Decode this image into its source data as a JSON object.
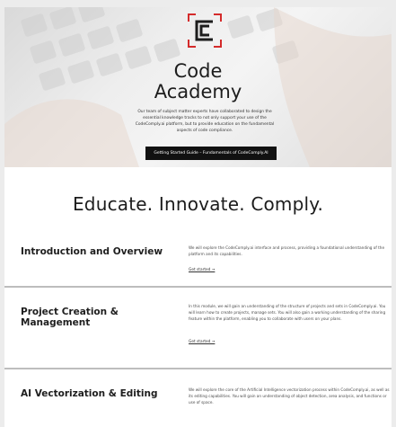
{
  "hero": {
    "title_line1": "Code",
    "title_line2": "Academy",
    "description": "Our team of subject matter experts have collaborated to design the essential knowledge tracks to not only support your use of the CodeComply.ai platform, but to provide education on the fundamental aspects of code compliance.",
    "button_label": "Getting Started Guide – Fundamentals of CodeComply.AI",
    "logo_icon": "code-academy-logo",
    "accent_color": "#d42b2b"
  },
  "tagline": "Educate. Innovate. Comply.",
  "modules": [
    {
      "title": "Introduction and Overview",
      "description": "We will explore the CodeComply.ai interface and process, providing a foundational understanding of the platform and its capabilities.",
      "link_label": "Get started →"
    },
    {
      "title": "Project Creation & Management",
      "description": "In this module, we will gain an understanding of the structure of projects and sets in CodeComply.ai. You will learn how to create projects, manage sets. You will also gain a working understanding of the sharing feature within the platform, enabling you to collaborate with users on your plans.",
      "link_label": "Get started →"
    },
    {
      "title": "AI Vectorization & Editing",
      "description": "We will explore the core of the Artificial Intelligence vectorization process within CodeComply.ai, as well as its editing capabilities. You will gain an understanding of object detection, area analysis, and functions or use of space.",
      "link_label": ""
    }
  ]
}
